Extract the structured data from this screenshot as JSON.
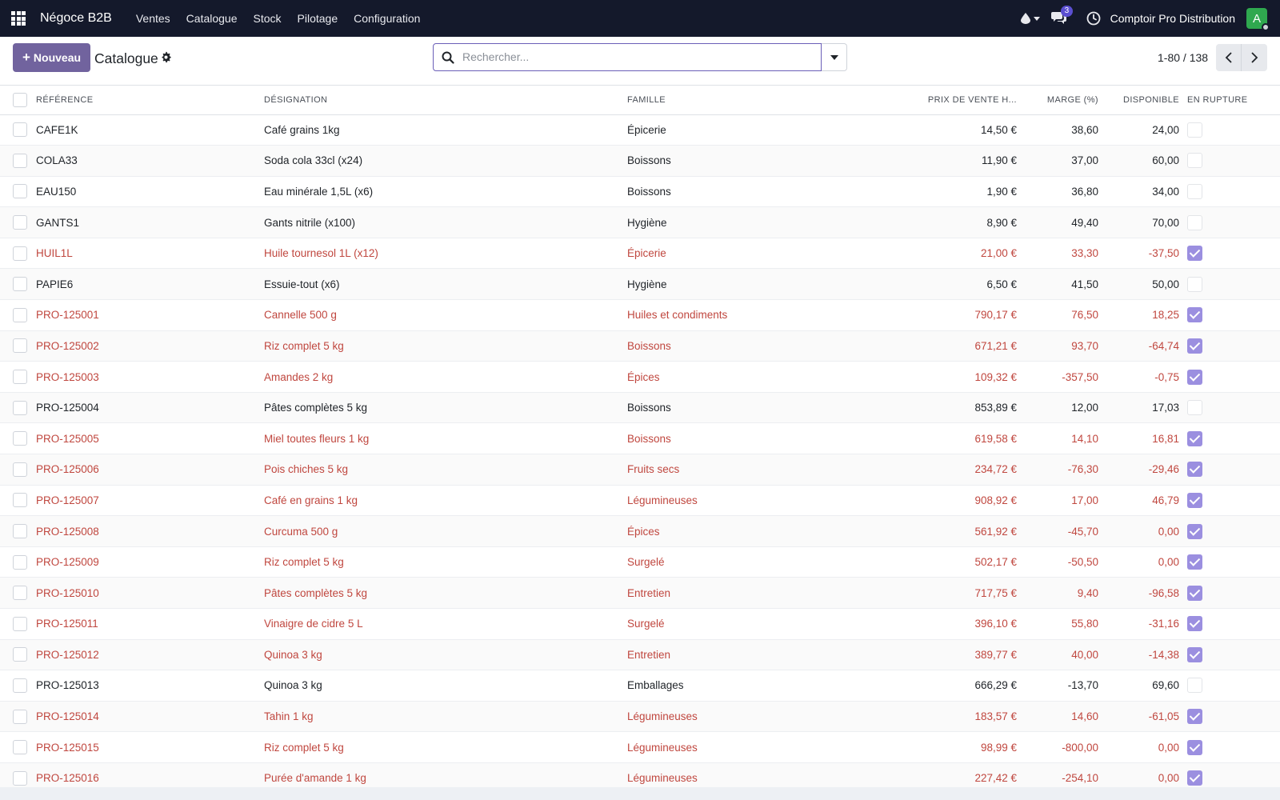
{
  "navbar": {
    "brand": "Négoce B2B",
    "menu": [
      "Ventes",
      "Catalogue",
      "Stock",
      "Pilotage",
      "Configuration"
    ],
    "chat_count": "3",
    "company": "Comptoir Pro Distribution",
    "avatar_letter": "A"
  },
  "control": {
    "new_button": "Nouveau",
    "title": "Catalogue",
    "search_placeholder": "Rechercher...",
    "pager": "1-80 / 138"
  },
  "columns": {
    "reference": "RÉFÉRENCE",
    "designation": "DÉSIGNATION",
    "famille": "FAMILLE",
    "prix": "PRIX DE VENTE H...",
    "marge": "MARGE (%)",
    "disponible": "DISPONIBLE",
    "rupture": "EN RUPTURE"
  },
  "rows": [
    {
      "ref": "CAFE1K",
      "designation": "Café grains 1kg",
      "famille": "Épicerie",
      "prix": "14,50 €",
      "marge": "38,60",
      "dispo": "24,00",
      "rupture": false
    },
    {
      "ref": "COLA33",
      "designation": "Soda cola 33cl (x24)",
      "famille": "Boissons",
      "prix": "11,90 €",
      "marge": "37,00",
      "dispo": "60,00",
      "rupture": false
    },
    {
      "ref": "EAU150",
      "designation": "Eau minérale 1,5L (x6)",
      "famille": "Boissons",
      "prix": "1,90 €",
      "marge": "36,80",
      "dispo": "34,00",
      "rupture": false
    },
    {
      "ref": "GANTS1",
      "designation": "Gants nitrile (x100)",
      "famille": "Hygiène",
      "prix": "8,90 €",
      "marge": "49,40",
      "dispo": "70,00",
      "rupture": false
    },
    {
      "ref": "HUIL1L",
      "designation": "Huile tournesol 1L (x12)",
      "famille": "Épicerie",
      "prix": "21,00 €",
      "marge": "33,30",
      "dispo": "-37,50",
      "rupture": true
    },
    {
      "ref": "PAPIE6",
      "designation": "Essuie-tout (x6)",
      "famille": "Hygiène",
      "prix": "6,50 €",
      "marge": "41,50",
      "dispo": "50,00",
      "rupture": false
    },
    {
      "ref": "PRO-125001",
      "designation": "Cannelle 500 g",
      "famille": "Huiles et condiments",
      "prix": "790,17 €",
      "marge": "76,50",
      "dispo": "18,25",
      "rupture": true
    },
    {
      "ref": "PRO-125002",
      "designation": "Riz complet 5 kg",
      "famille": "Boissons",
      "prix": "671,21 €",
      "marge": "93,70",
      "dispo": "-64,74",
      "rupture": true
    },
    {
      "ref": "PRO-125003",
      "designation": "Amandes 2 kg",
      "famille": "Épices",
      "prix": "109,32 €",
      "marge": "-357,50",
      "dispo": "-0,75",
      "rupture": true
    },
    {
      "ref": "PRO-125004",
      "designation": "Pâtes complètes 5 kg",
      "famille": "Boissons",
      "prix": "853,89 €",
      "marge": "12,00",
      "dispo": "17,03",
      "rupture": false
    },
    {
      "ref": "PRO-125005",
      "designation": "Miel toutes fleurs 1 kg",
      "famille": "Boissons",
      "prix": "619,58 €",
      "marge": "14,10",
      "dispo": "16,81",
      "rupture": true
    },
    {
      "ref": "PRO-125006",
      "designation": "Pois chiches 5 kg",
      "famille": "Fruits secs",
      "prix": "234,72 €",
      "marge": "-76,30",
      "dispo": "-29,46",
      "rupture": true
    },
    {
      "ref": "PRO-125007",
      "designation": "Café en grains 1 kg",
      "famille": "Légumineuses",
      "prix": "908,92 €",
      "marge": "17,00",
      "dispo": "46,79",
      "rupture": true
    },
    {
      "ref": "PRO-125008",
      "designation": "Curcuma 500 g",
      "famille": "Épices",
      "prix": "561,92 €",
      "marge": "-45,70",
      "dispo": "0,00",
      "rupture": true
    },
    {
      "ref": "PRO-125009",
      "designation": "Riz complet 5 kg",
      "famille": "Surgelé",
      "prix": "502,17 €",
      "marge": "-50,50",
      "dispo": "0,00",
      "rupture": true
    },
    {
      "ref": "PRO-125010",
      "designation": "Pâtes complètes 5 kg",
      "famille": "Entretien",
      "prix": "717,75 €",
      "marge": "9,40",
      "dispo": "-96,58",
      "rupture": true
    },
    {
      "ref": "PRO-125011",
      "designation": "Vinaigre de cidre 5 L",
      "famille": "Surgelé",
      "prix": "396,10 €",
      "marge": "55,80",
      "dispo": "-31,16",
      "rupture": true
    },
    {
      "ref": "PRO-125012",
      "designation": "Quinoa 3 kg",
      "famille": "Entretien",
      "prix": "389,77 €",
      "marge": "40,00",
      "dispo": "-14,38",
      "rupture": true
    },
    {
      "ref": "PRO-125013",
      "designation": "Quinoa 3 kg",
      "famille": "Emballages",
      "prix": "666,29 €",
      "marge": "-13,70",
      "dispo": "69,60",
      "rupture": false
    },
    {
      "ref": "PRO-125014",
      "designation": "Tahin 1 kg",
      "famille": "Légumineuses",
      "prix": "183,57 €",
      "marge": "14,60",
      "dispo": "-61,05",
      "rupture": true
    },
    {
      "ref": "PRO-125015",
      "designation": "Riz complet 5 kg",
      "famille": "Légumineuses",
      "prix": "98,99 €",
      "marge": "-800,00",
      "dispo": "0,00",
      "rupture": true
    },
    {
      "ref": "PRO-125016",
      "designation": "Purée d'amande 1 kg",
      "famille": "Légumineuses",
      "prix": "227,42 €",
      "marge": "-254,10",
      "dispo": "0,00",
      "rupture": true
    }
  ],
  "colors": {
    "navbar_bg": "#14192b",
    "primary": "#71639e",
    "alert_text": "#c0473f",
    "checkbox_checked": "#9b8fe0",
    "avatar_bg": "#2fa84f",
    "badge_bg": "#5b4fd1"
  }
}
